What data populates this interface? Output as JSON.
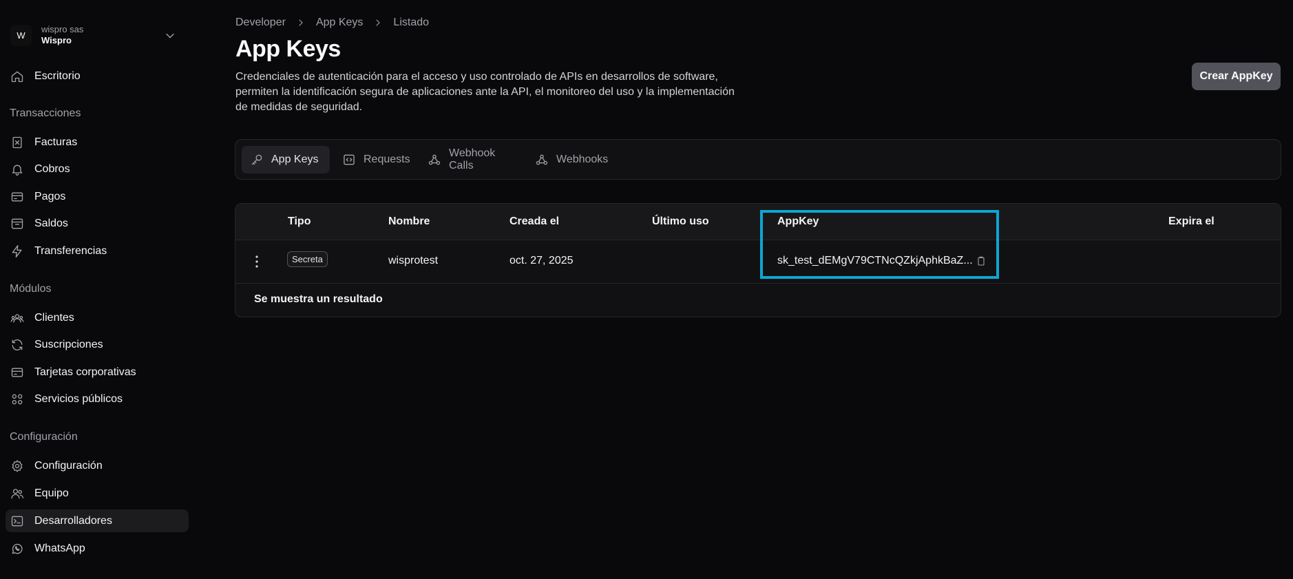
{
  "org": {
    "avatar": "W",
    "subtitle": "wispro sas",
    "name": "Wispro"
  },
  "sidebar": {
    "top_item": {
      "label": "Escritorio",
      "icon": "home-icon"
    },
    "sections": [
      {
        "title": "Transacciones",
        "items": [
          {
            "label": "Facturas",
            "icon": "invoice-icon"
          },
          {
            "label": "Cobros",
            "icon": "bell-icon"
          },
          {
            "label": "Pagos",
            "icon": "card-icon"
          },
          {
            "label": "Saldos",
            "icon": "inbox-icon"
          },
          {
            "label": "Transferencias",
            "icon": "bolt-icon"
          }
        ]
      },
      {
        "title": "Módulos",
        "items": [
          {
            "label": "Clientes",
            "icon": "users-group-icon"
          },
          {
            "label": "Suscripciones",
            "icon": "refresh-icon"
          },
          {
            "label": "Tarjetas corporativas",
            "icon": "card-icon"
          },
          {
            "label": "Servicios públicos",
            "icon": "grid-icon"
          }
        ]
      },
      {
        "title": "Configuración",
        "items": [
          {
            "label": "Configuración",
            "icon": "gear-icon"
          },
          {
            "label": "Equipo",
            "icon": "users-icon"
          },
          {
            "label": "Desarrolladores",
            "icon": "terminal-icon",
            "active": true
          },
          {
            "label": "WhatsApp",
            "icon": "whatsapp-icon"
          }
        ]
      }
    ]
  },
  "breadcrumb": [
    "Developer",
    "App Keys",
    "Listado"
  ],
  "page": {
    "title": "App Keys",
    "description": "Credenciales de autenticación para el acceso y uso controlado de APIs en desarrollos de software, permiten la identificación segura de aplicaciones ante la API, el monitoreo del uso y la implementación de medidas de seguridad.",
    "primary_button": "Crear AppKey"
  },
  "tabs": [
    {
      "label": "App Keys",
      "icon": "key-icon",
      "active": true
    },
    {
      "label": "Requests",
      "icon": "code-icon"
    },
    {
      "label": "Webhook Calls",
      "icon": "webhook-icon"
    },
    {
      "label": "Webhooks",
      "icon": "webhook-icon"
    }
  ],
  "table": {
    "columns": [
      "Tipo",
      "Nombre",
      "Creada el",
      "Último uso",
      "AppKey",
      "Expira el"
    ],
    "rows": [
      {
        "tipo": "Secreta",
        "nombre": "wisprotest",
        "creada": "oct. 27, 2025",
        "ultimo_uso": "",
        "appkey": "sk_test_dEMgV79CTNcQZkjAphkBaZ...",
        "expira": ""
      }
    ],
    "footer": "Se muestra un resultado"
  },
  "colors": {
    "background": "#09090b",
    "highlight": "#0ea5d3",
    "button": "#52525b"
  }
}
